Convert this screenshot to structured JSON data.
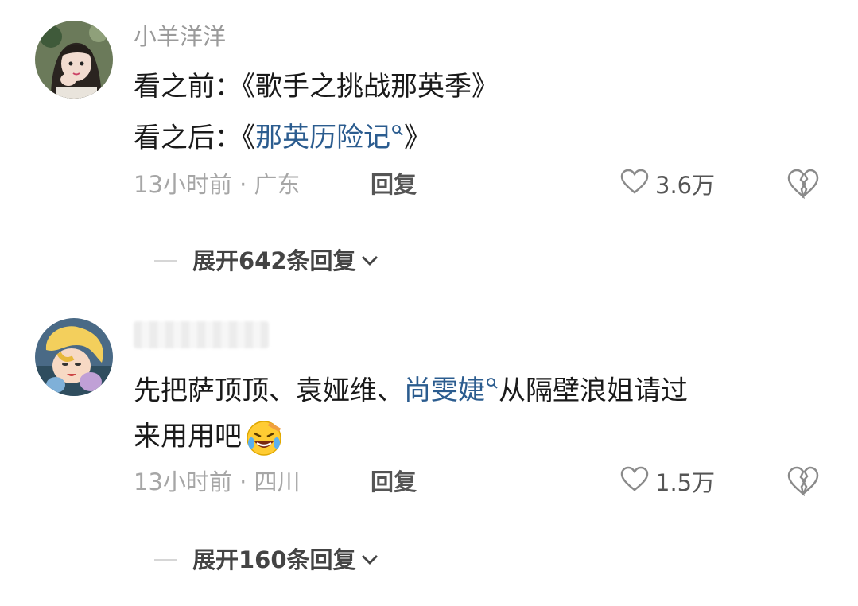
{
  "comments": [
    {
      "username": "小羊洋洋",
      "line1_prefix": "看之前：《歌手之挑战那英季》",
      "line2_prefix": "看之后：《",
      "line2_link": "那英历险记",
      "line2_suffix": "》",
      "meta": "13小时前 · 广东",
      "reply_label": "回复",
      "like_count": "3.6万",
      "expand_label": "展开642条回复",
      "avatar_icon": "girl-avatar"
    },
    {
      "username": "",
      "text_prefix": "先把萨顶顶、袁娅维、",
      "text_link": "尚雯婕",
      "text_suffix": "从隔壁浪姐请过",
      "text_line2": "来用用吧",
      "emoji": "laughing-crying-emoji",
      "meta": "13小时前 · 四川",
      "reply_label": "回复",
      "like_count": "1.5万",
      "expand_label": "展开160条回复",
      "avatar_icon": "cartoon-avatar"
    }
  ],
  "colors": {
    "link": "#2b5c8f",
    "meta": "#a6a6a6",
    "username": "#9a9a9a"
  }
}
